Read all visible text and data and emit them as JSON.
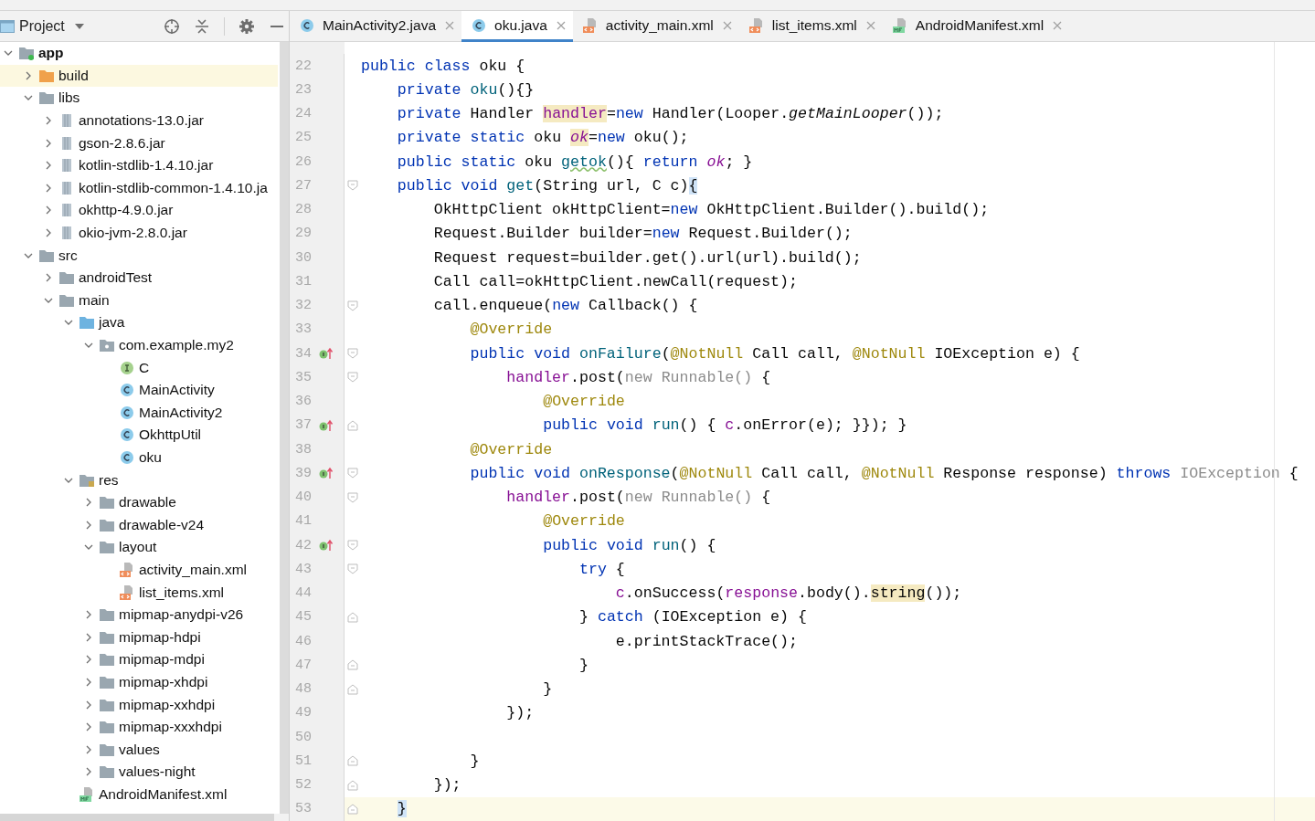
{
  "sidebar": {
    "title": "Project",
    "tree": [
      {
        "label": "app",
        "kind": "module",
        "expanded": true,
        "selected": false,
        "children": [
          {
            "label": "build",
            "kind": "excluded-folder",
            "expanded": false,
            "selected": true
          },
          {
            "label": "libs",
            "kind": "folder",
            "expanded": true,
            "selected": false,
            "children": [
              {
                "label": "annotations-13.0.jar",
                "kind": "jar",
                "expanded": false,
                "selected": false
              },
              {
                "label": "gson-2.8.6.jar",
                "kind": "jar",
                "expanded": false,
                "selected": false
              },
              {
                "label": "kotlin-stdlib-1.4.10.jar",
                "kind": "jar",
                "expanded": false,
                "selected": false
              },
              {
                "label": "kotlin-stdlib-common-1.4.10.ja",
                "kind": "jar",
                "expanded": false,
                "selected": false
              },
              {
                "label": "okhttp-4.9.0.jar",
                "kind": "jar",
                "expanded": false,
                "selected": false
              },
              {
                "label": "okio-jvm-2.8.0.jar",
                "kind": "jar",
                "expanded": false,
                "selected": false
              }
            ]
          },
          {
            "label": "src",
            "kind": "folder",
            "expanded": true,
            "selected": false,
            "children": [
              {
                "label": "androidTest",
                "kind": "folder",
                "expanded": false,
                "selected": false
              },
              {
                "label": "main",
                "kind": "folder",
                "expanded": true,
                "selected": false,
                "children": [
                  {
                    "label": "java",
                    "kind": "source-folder",
                    "expanded": true,
                    "selected": false,
                    "children": [
                      {
                        "label": "com.example.my2",
                        "kind": "package",
                        "expanded": true,
                        "selected": false,
                        "children": [
                          {
                            "label": "C",
                            "kind": "interface",
                            "selected": false
                          },
                          {
                            "label": "MainActivity",
                            "kind": "class",
                            "selected": false
                          },
                          {
                            "label": "MainActivity2",
                            "kind": "class",
                            "selected": false
                          },
                          {
                            "label": "OkhttpUtil",
                            "kind": "class",
                            "selected": false
                          },
                          {
                            "label": "oku",
                            "kind": "class",
                            "selected": false
                          }
                        ]
                      }
                    ]
                  },
                  {
                    "label": "res",
                    "kind": "res-folder",
                    "expanded": true,
                    "selected": false,
                    "children": [
                      {
                        "label": "drawable",
                        "kind": "folder",
                        "expanded": false,
                        "selected": false
                      },
                      {
                        "label": "drawable-v24",
                        "kind": "folder",
                        "expanded": false,
                        "selected": false
                      },
                      {
                        "label": "layout",
                        "kind": "folder",
                        "expanded": true,
                        "selected": false,
                        "children": [
                          {
                            "label": "activity_main.xml",
                            "kind": "xml",
                            "selected": false
                          },
                          {
                            "label": "list_items.xml",
                            "kind": "xml",
                            "selected": false
                          }
                        ]
                      },
                      {
                        "label": "mipmap-anydpi-v26",
                        "kind": "folder",
                        "expanded": false,
                        "selected": false
                      },
                      {
                        "label": "mipmap-hdpi",
                        "kind": "folder",
                        "expanded": false,
                        "selected": false
                      },
                      {
                        "label": "mipmap-mdpi",
                        "kind": "folder",
                        "expanded": false,
                        "selected": false
                      },
                      {
                        "label": "mipmap-xhdpi",
                        "kind": "folder",
                        "expanded": false,
                        "selected": false
                      },
                      {
                        "label": "mipmap-xxhdpi",
                        "kind": "folder",
                        "expanded": false,
                        "selected": false
                      },
                      {
                        "label": "mipmap-xxxhdpi",
                        "kind": "folder",
                        "expanded": false,
                        "selected": false
                      },
                      {
                        "label": "values",
                        "kind": "folder",
                        "expanded": false,
                        "selected": false
                      },
                      {
                        "label": "values-night",
                        "kind": "folder",
                        "expanded": false,
                        "selected": false
                      }
                    ]
                  },
                  {
                    "label": "AndroidManifest.xml",
                    "kind": "manifest",
                    "selected": false
                  }
                ]
              }
            ]
          }
        ]
      }
    ]
  },
  "tabs": [
    {
      "label": "MainActivity2.java",
      "kind": "class",
      "selected": false
    },
    {
      "label": "oku.java",
      "kind": "class",
      "selected": true
    },
    {
      "label": "activity_main.xml",
      "kind": "xml",
      "selected": false
    },
    {
      "label": "list_items.xml",
      "kind": "xml",
      "selected": false
    },
    {
      "label": "AndroidManifest.xml",
      "kind": "manifest",
      "selected": false
    }
  ],
  "editor": {
    "lines": [
      {
        "n": "22",
        "current": false,
        "override_mark": false,
        "fold_start": false,
        "fold_end": false,
        "tokens": [
          {
            "text": "public class ",
            "kind": "keyword"
          },
          {
            "text": "oku {",
            "kind": "plain"
          }
        ]
      },
      {
        "n": "23",
        "current": false,
        "override_mark": false,
        "fold_start": false,
        "fold_end": false,
        "tokens": [
          {
            "text": "    private ",
            "kind": "keyword"
          },
          {
            "text": "oku",
            "kind": "method"
          },
          {
            "text": "(){}",
            "kind": "plain"
          }
        ]
      },
      {
        "n": "24",
        "current": false,
        "override_mark": false,
        "fold_start": false,
        "fold_end": false,
        "tokens": [
          {
            "text": "    private ",
            "kind": "keyword"
          },
          {
            "text": "Handler ",
            "kind": "plain"
          },
          {
            "text": "handler",
            "kind": "highlighted-field"
          },
          {
            "text": "=",
            "kind": "plain"
          },
          {
            "text": "new ",
            "kind": "keyword"
          },
          {
            "text": "Handler(Looper.",
            "kind": "plain"
          },
          {
            "text": "getMainLooper",
            "kind": "static-call"
          },
          {
            "text": "());",
            "kind": "plain"
          }
        ]
      },
      {
        "n": "25",
        "current": false,
        "override_mark": false,
        "fold_start": false,
        "fold_end": false,
        "tokens": [
          {
            "text": "    private static ",
            "kind": "keyword"
          },
          {
            "text": "oku ",
            "kind": "plain"
          },
          {
            "text": "ok",
            "kind": "highlighted-static"
          },
          {
            "text": "=",
            "kind": "plain"
          },
          {
            "text": "new ",
            "kind": "keyword"
          },
          {
            "text": "oku();",
            "kind": "plain"
          }
        ]
      },
      {
        "n": "26",
        "current": false,
        "override_mark": false,
        "fold_start": false,
        "fold_end": false,
        "tokens": [
          {
            "text": "    public static ",
            "kind": "keyword"
          },
          {
            "text": "oku ",
            "kind": "plain"
          },
          {
            "text": "getok",
            "kind": "warned-method"
          },
          {
            "text": "(){ ",
            "kind": "plain"
          },
          {
            "text": "return ",
            "kind": "keyword"
          },
          {
            "text": "ok",
            "kind": "static-field"
          },
          {
            "text": "; }",
            "kind": "plain"
          }
        ]
      },
      {
        "n": "27",
        "current": false,
        "override_mark": false,
        "fold_start": true,
        "fold_end": false,
        "tokens": [
          {
            "text": "    public void ",
            "kind": "keyword"
          },
          {
            "text": "get",
            "kind": "method"
          },
          {
            "text": "(String url, C c)",
            "kind": "plain"
          },
          {
            "text": "{",
            "kind": "brace"
          }
        ]
      },
      {
        "n": "28",
        "current": false,
        "override_mark": false,
        "fold_start": false,
        "fold_end": false,
        "tokens": [
          {
            "text": "        OkHttpClient okHttpClient=",
            "kind": "plain"
          },
          {
            "text": "new ",
            "kind": "keyword"
          },
          {
            "text": "OkHttpClient.Builder().build();",
            "kind": "plain"
          }
        ]
      },
      {
        "n": "29",
        "current": false,
        "override_mark": false,
        "fold_start": false,
        "fold_end": false,
        "tokens": [
          {
            "text": "        Request.Builder builder=",
            "kind": "plain"
          },
          {
            "text": "new ",
            "kind": "keyword"
          },
          {
            "text": "Request.Builder();",
            "kind": "plain"
          }
        ]
      },
      {
        "n": "30",
        "current": false,
        "override_mark": false,
        "fold_start": false,
        "fold_end": false,
        "tokens": [
          {
            "text": "        Request request=builder.get().url(url).build();",
            "kind": "plain"
          }
        ]
      },
      {
        "n": "31",
        "current": false,
        "override_mark": false,
        "fold_start": false,
        "fold_end": false,
        "tokens": [
          {
            "text": "        Call call=okHttpClient.newCall(request);",
            "kind": "plain"
          }
        ]
      },
      {
        "n": "32",
        "current": false,
        "override_mark": false,
        "fold_start": true,
        "fold_end": false,
        "tokens": [
          {
            "text": "        call.enqueue(",
            "kind": "plain"
          },
          {
            "text": "new ",
            "kind": "keyword"
          },
          {
            "text": "Callback() {",
            "kind": "plain"
          }
        ]
      },
      {
        "n": "33",
        "current": false,
        "override_mark": false,
        "fold_start": false,
        "fold_end": false,
        "tokens": [
          {
            "text": "            @Override",
            "kind": "annotation"
          }
        ]
      },
      {
        "n": "34",
        "current": false,
        "override_mark": true,
        "fold_start": true,
        "fold_end": false,
        "tokens": [
          {
            "text": "            public void ",
            "kind": "keyword"
          },
          {
            "text": "onFailure",
            "kind": "method"
          },
          {
            "text": "(",
            "kind": "plain"
          },
          {
            "text": "@NotNull ",
            "kind": "annotation"
          },
          {
            "text": "Call call, ",
            "kind": "plain"
          },
          {
            "text": "@NotNull ",
            "kind": "annotation"
          },
          {
            "text": "IOException e) {",
            "kind": "plain"
          }
        ]
      },
      {
        "n": "35",
        "current": false,
        "override_mark": false,
        "fold_start": true,
        "fold_end": false,
        "tokens": [
          {
            "text": "                handler",
            "kind": "field"
          },
          {
            "text": ".post(",
            "kind": "plain"
          },
          {
            "text": "new Runnable() ",
            "kind": "unused"
          },
          {
            "text": "{",
            "kind": "plain"
          }
        ]
      },
      {
        "n": "36",
        "current": false,
        "override_mark": false,
        "fold_start": false,
        "fold_end": false,
        "tokens": [
          {
            "text": "                    @Override",
            "kind": "annotation"
          }
        ]
      },
      {
        "n": "37",
        "current": false,
        "override_mark": true,
        "fold_start": false,
        "fold_end": true,
        "tokens": [
          {
            "text": "                    public void ",
            "kind": "keyword"
          },
          {
            "text": "run",
            "kind": "method"
          },
          {
            "text": "() { ",
            "kind": "plain"
          },
          {
            "text": "c",
            "kind": "field"
          },
          {
            "text": ".onError(e); }}); }",
            "kind": "plain"
          }
        ]
      },
      {
        "n": "38",
        "current": false,
        "override_mark": false,
        "fold_start": false,
        "fold_end": false,
        "tokens": [
          {
            "text": "            @Override",
            "kind": "annotation"
          }
        ]
      },
      {
        "n": "39",
        "current": false,
        "override_mark": true,
        "fold_start": true,
        "fold_end": false,
        "tokens": [
          {
            "text": "            public void ",
            "kind": "keyword"
          },
          {
            "text": "onResponse",
            "kind": "method"
          },
          {
            "text": "(",
            "kind": "plain"
          },
          {
            "text": "@NotNull ",
            "kind": "annotation"
          },
          {
            "text": "Call call, ",
            "kind": "plain"
          },
          {
            "text": "@NotNull ",
            "kind": "annotation"
          },
          {
            "text": "Response response) ",
            "kind": "plain"
          },
          {
            "text": "throws ",
            "kind": "keyword"
          },
          {
            "text": "IOException ",
            "kind": "unused"
          },
          {
            "text": "{",
            "kind": "plain"
          }
        ]
      },
      {
        "n": "40",
        "current": false,
        "override_mark": false,
        "fold_start": true,
        "fold_end": false,
        "tokens": [
          {
            "text": "                handler",
            "kind": "field"
          },
          {
            "text": ".post(",
            "kind": "plain"
          },
          {
            "text": "new Runnable() ",
            "kind": "unused"
          },
          {
            "text": "{",
            "kind": "plain"
          }
        ]
      },
      {
        "n": "41",
        "current": false,
        "override_mark": false,
        "fold_start": false,
        "fold_end": false,
        "tokens": [
          {
            "text": "                    @Override",
            "kind": "annotation"
          }
        ]
      },
      {
        "n": "42",
        "current": false,
        "override_mark": true,
        "fold_start": true,
        "fold_end": false,
        "tokens": [
          {
            "text": "                    public void ",
            "kind": "keyword"
          },
          {
            "text": "run",
            "kind": "method"
          },
          {
            "text": "() {",
            "kind": "plain"
          }
        ]
      },
      {
        "n": "43",
        "current": false,
        "override_mark": false,
        "fold_start": true,
        "fold_end": false,
        "tokens": [
          {
            "text": "                        try ",
            "kind": "keyword"
          },
          {
            "text": "{",
            "kind": "plain"
          }
        ]
      },
      {
        "n": "44",
        "current": false,
        "override_mark": false,
        "fold_start": false,
        "fold_end": false,
        "tokens": [
          {
            "text": "                            c",
            "kind": "field"
          },
          {
            "text": ".onSuccess(",
            "kind": "plain"
          },
          {
            "text": "response",
            "kind": "field"
          },
          {
            "text": ".body().",
            "kind": "plain"
          },
          {
            "text": "string",
            "kind": "highlighted"
          },
          {
            "text": "());",
            "kind": "plain"
          }
        ]
      },
      {
        "n": "45",
        "current": false,
        "override_mark": false,
        "fold_start": false,
        "fold_end": true,
        "tokens": [
          {
            "text": "                        } ",
            "kind": "plain"
          },
          {
            "text": "catch ",
            "kind": "keyword"
          },
          {
            "text": "(IOException e) {",
            "kind": "plain"
          }
        ]
      },
      {
        "n": "46",
        "current": false,
        "override_mark": false,
        "fold_start": false,
        "fold_end": false,
        "tokens": [
          {
            "text": "                            e.printStackTrace();",
            "kind": "plain"
          }
        ]
      },
      {
        "n": "47",
        "current": false,
        "override_mark": false,
        "fold_start": false,
        "fold_end": true,
        "tokens": [
          {
            "text": "                        }",
            "kind": "plain"
          }
        ]
      },
      {
        "n": "48",
        "current": false,
        "override_mark": false,
        "fold_start": false,
        "fold_end": true,
        "tokens": [
          {
            "text": "                    }",
            "kind": "plain"
          }
        ]
      },
      {
        "n": "49",
        "current": false,
        "override_mark": false,
        "fold_start": false,
        "fold_end": false,
        "tokens": [
          {
            "text": "                });",
            "kind": "plain"
          }
        ]
      },
      {
        "n": "50",
        "current": false,
        "override_mark": false,
        "fold_start": false,
        "fold_end": false
      },
      {
        "n": "51",
        "current": false,
        "override_mark": false,
        "fold_start": false,
        "fold_end": true,
        "tokens": [
          {
            "text": "            }",
            "kind": "plain"
          }
        ]
      },
      {
        "n": "52",
        "current": false,
        "override_mark": false,
        "fold_start": false,
        "fold_end": true,
        "tokens": [
          {
            "text": "        });",
            "kind": "plain"
          }
        ]
      },
      {
        "n": "53",
        "current": true,
        "override_mark": false,
        "fold_start": false,
        "fold_end": true,
        "tokens": [
          {
            "text": "    }",
            "kind": "brace"
          }
        ]
      }
    ]
  }
}
